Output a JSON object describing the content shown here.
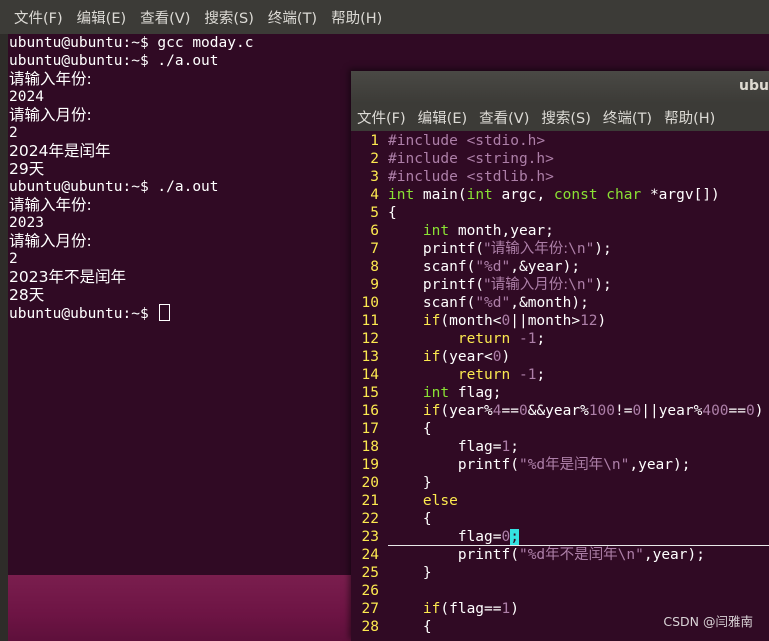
{
  "term1": {
    "menu": [
      "文件(F)",
      "编辑(E)",
      "查看(V)",
      "搜索(S)",
      "终端(T)",
      "帮助(H)"
    ],
    "lines": [
      "ubuntu@ubuntu:~$ gcc moday.c",
      "ubuntu@ubuntu:~$ ./a.out",
      "请输入年份:",
      "2024",
      "请输入月份:",
      "2",
      "2024年是闰年",
      "29天",
      "ubuntu@ubuntu:~$ ./a.out",
      "请输入年份:",
      "2023",
      "请输入月份:",
      "2",
      "2023年不是闰年",
      "28天"
    ],
    "prompt": "ubuntu@ubuntu:~$ "
  },
  "term2": {
    "title": "ubu",
    "menu": [
      "文件(F)",
      "编辑(E)",
      "查看(V)",
      "搜索(S)",
      "终端(T)",
      "帮助(H)"
    ],
    "line_numbers": [
      "1",
      "2",
      "3",
      "4",
      "5",
      "6",
      "7",
      "8",
      "9",
      "10",
      "11",
      "12",
      "13",
      "14",
      "15",
      "16",
      "17",
      "18",
      "19",
      "20",
      "21",
      "22",
      "23",
      "24",
      "25",
      "26",
      "27",
      "28"
    ],
    "code": {
      "l1a": "#include",
      "l1b": " <stdio.h>",
      "l2a": "#include",
      "l2b": " <string.h>",
      "l3a": "#include",
      "l3b": " <stdlib.h>",
      "l4a": "int",
      "l4b": " main(",
      "l4c": "int",
      "l4d": " argc, ",
      "l4e": "const",
      "l4f": " ",
      "l4g": "char",
      "l4h": " *argv[])",
      "l5": "{",
      "l6a": "    ",
      "l6b": "int",
      "l6c": " month,year;",
      "l7a": "    printf(",
      "l7b": "\"请输入年份:",
      "l7c": "\\n",
      "l7d": "\"",
      "l7e": ");",
      "l8a": "    scanf(",
      "l8b": "\"",
      "l8c": "%d",
      "l8d": "\"",
      "l8e": ",&year);",
      "l9a": "    printf(",
      "l9b": "\"请输入月份:",
      "l9c": "\\n",
      "l9d": "\"",
      "l9e": ");",
      "l10a": "    scanf(",
      "l10b": "\"",
      "l10c": "%d",
      "l10d": "\"",
      "l10e": ",&month);",
      "l11a": "    ",
      "l11b": "if",
      "l11c": "(month<",
      "l11d": "0",
      "l11e": "||month>",
      "l11f": "12",
      "l11g": ")",
      "l12a": "        ",
      "l12b": "return",
      "l12c": " -",
      "l12d": "1",
      "l12e": ";",
      "l13a": "    ",
      "l13b": "if",
      "l13c": "(year<",
      "l13d": "0",
      "l13e": ")",
      "l14a": "        ",
      "l14b": "return",
      "l14c": " -",
      "l14d": "1",
      "l14e": ";",
      "l15a": "    ",
      "l15b": "int",
      "l15c": " flag;",
      "l16a": "    ",
      "l16b": "if",
      "l16c": "(year%",
      "l16d": "4",
      "l16e": "==",
      "l16f": "0",
      "l16g": "&&year%",
      "l16h": "100",
      "l16i": "!=",
      "l16j": "0",
      "l16k": "||year%",
      "l16l": "400",
      "l16m": "==",
      "l16n": "0",
      "l16o": ")",
      "l17": "    {",
      "l18a": "        flag=",
      "l18b": "1",
      "l18c": ";",
      "l19a": "        printf(",
      "l19b": "\"",
      "l19c": "%d",
      "l19d": "年是闰年",
      "l19e": "\\n",
      "l19f": "\"",
      "l19g": ",year);",
      "l20": "    }",
      "l21a": "    ",
      "l21b": "else",
      "l22": "    {",
      "l23a": "        flag=",
      "l23b": "0",
      "l23c": ";",
      "l24a": "        printf(",
      "l24b": "\"",
      "l24c": "%d",
      "l24d": "年不是闰年",
      "l24e": "\\n",
      "l24f": "\"",
      "l24g": ",year);",
      "l25": "    }",
      "l26": "",
      "l27a": "    ",
      "l27b": "if",
      "l27c": "(flag==",
      "l27d": "1",
      "l27e": ")",
      "l28": "    {"
    },
    "watermark": "CSDN @闫雅南"
  },
  "colors": {
    "terminal_bg": "#300a24",
    "line_number": "#fce94f",
    "keyword": "#fce94f",
    "type": "#8ae234",
    "string_constant": "#ad7fa8",
    "cursor": "#34e2e2"
  }
}
